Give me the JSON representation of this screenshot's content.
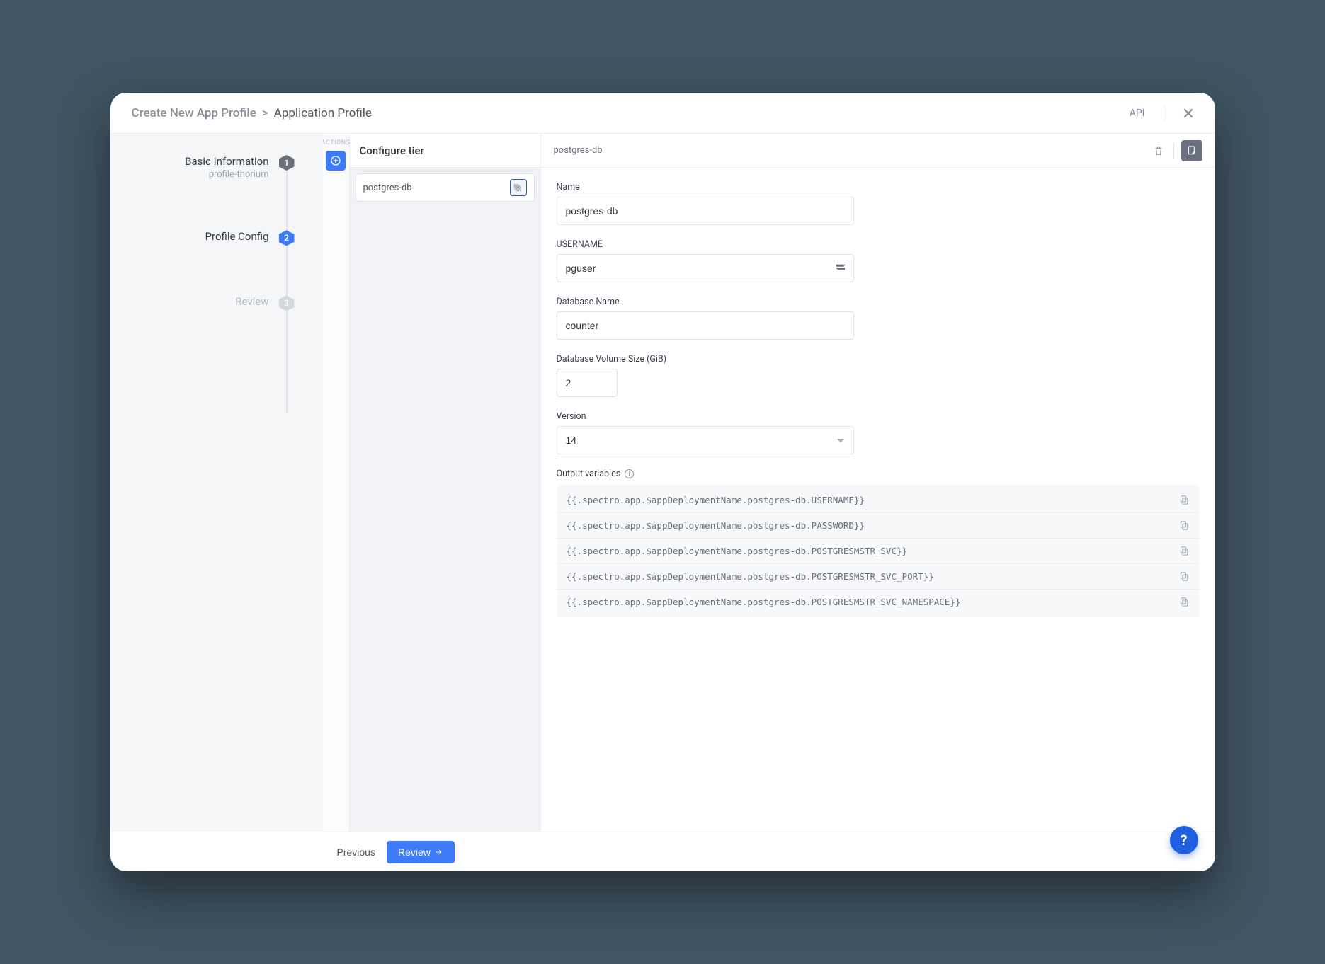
{
  "header": {
    "crumb_main": "Create New App Profile",
    "sep": ">",
    "crumb_sub": "Application Profile",
    "api_label": "API"
  },
  "steps": [
    {
      "title": "Basic Information",
      "subtitle": "profile-thorium",
      "num": "1",
      "state": "done"
    },
    {
      "title": "Profile Config",
      "subtitle": "",
      "num": "2",
      "state": "active"
    },
    {
      "title": "Review",
      "subtitle": "",
      "num": "3",
      "state": "future"
    }
  ],
  "actions_label": "ACTIONS",
  "tiers": {
    "heading": "Configure tier",
    "items": [
      {
        "name": "postgres-db",
        "icon": "postgres"
      }
    ]
  },
  "panel": {
    "title": "postgres-db"
  },
  "form": {
    "name_label": "Name",
    "name_value": "postgres-db",
    "username_label": "USERNAME",
    "username_value": "pguser",
    "dbname_label": "Database Name",
    "dbname_value": "counter",
    "volume_label": "Database Volume Size (GiB)",
    "volume_value": "2",
    "version_label": "Version",
    "version_value": "14",
    "ov_label": "Output variables",
    "output_vars": [
      "{{.spectro.app.$appDeploymentName.postgres-db.USERNAME}}",
      "{{.spectro.app.$appDeploymentName.postgres-db.PASSWORD}}",
      "{{.spectro.app.$appDeploymentName.postgres-db.POSTGRESMSTR_SVC}}",
      "{{.spectro.app.$appDeploymentName.postgres-db.POSTGRESMSTR_SVC_PORT}}",
      "{{.spectro.app.$appDeploymentName.postgres-db.POSTGRESMSTR_SVC_NAMESPACE}}"
    ]
  },
  "footer": {
    "previous": "Previous",
    "review": "Review"
  },
  "help": "?"
}
